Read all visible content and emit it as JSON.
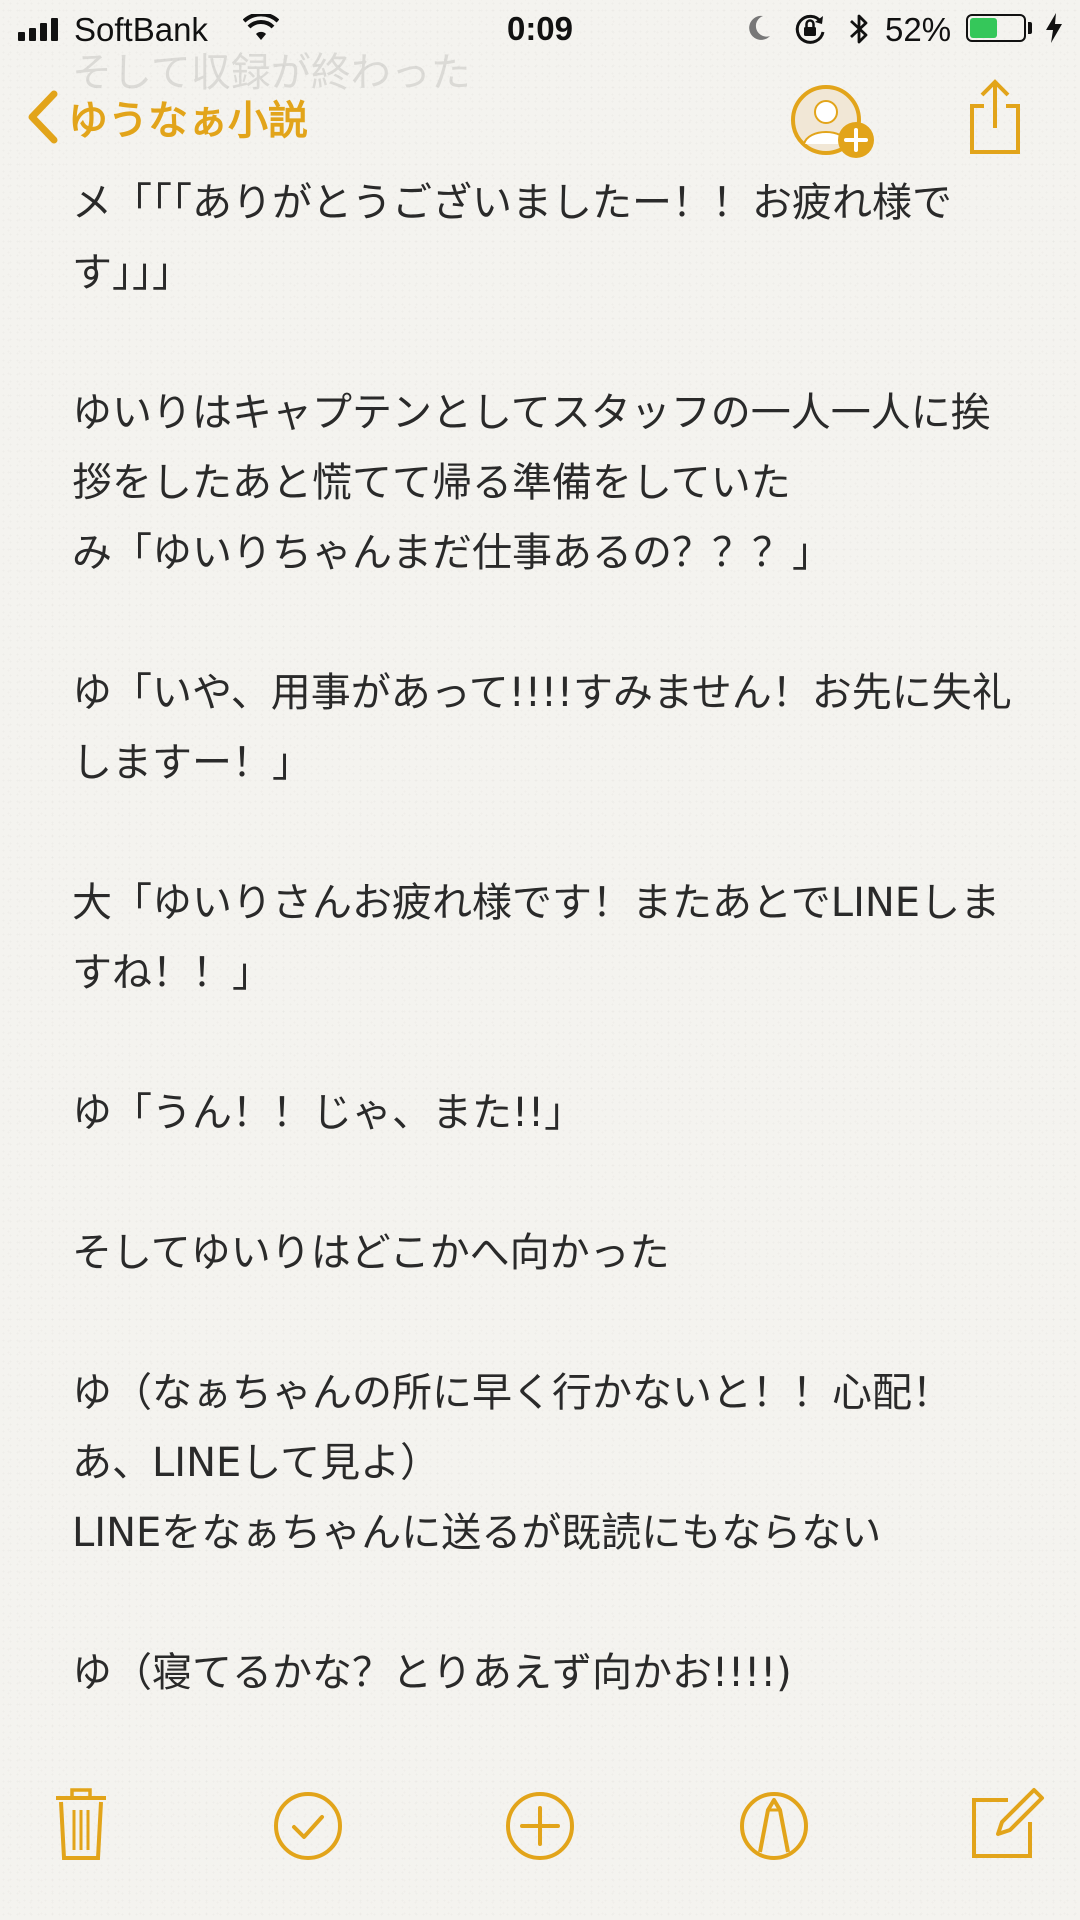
{
  "status_bar": {
    "carrier": "SoftBank",
    "time": "0:09",
    "battery_percent": "52%",
    "battery_level": 0.52,
    "icons": [
      "signal-bars-icon",
      "wifi-icon",
      "moon-icon",
      "orientation-lock-icon",
      "bluetooth-icon",
      "battery-icon",
      "charging-bolt-icon"
    ]
  },
  "nav": {
    "back_label": "ゆうなぁ小説",
    "icons": [
      "chevron-left-icon",
      "add-person-icon",
      "share-icon"
    ]
  },
  "scrolled_line": "そして収録が終わった",
  "note": {
    "paragraphs": [
      "メ「「「ありがとうございましたー！！お疲れ様です」」」",
      "ゆいりはキャプテンとしてスタッフの一人一人に挨拶をしたあと慌てて帰る準備をしていた\nみ「ゆいりちゃんまだ仕事あるの？？？」",
      "ゆ「いや、用事があって!!!!すみません！お先に失礼しますー！」",
      "大「ゆいりさんお疲れ様です！またあとでLINEしますね！！」",
      "ゆ「うん！！じゃ、また!!」",
      "そしてゆいりはどこかへ向かった",
      "ゆ（なぁちゃんの所に早く行かないと！！心配！あ、LINEして見よ）\nLINEをなぁちゃんに送るが既読にもならない",
      "ゆ（寝てるかな？とりあえず向かお!!!!)"
    ]
  },
  "toolbar": {
    "icons": [
      "trash-icon",
      "checklist-icon",
      "add-icon",
      "markup-icon",
      "compose-icon"
    ]
  },
  "colors": {
    "accent": "#e2a41a",
    "battery_fill": "#35c75a",
    "text": "#2a2a2a"
  }
}
